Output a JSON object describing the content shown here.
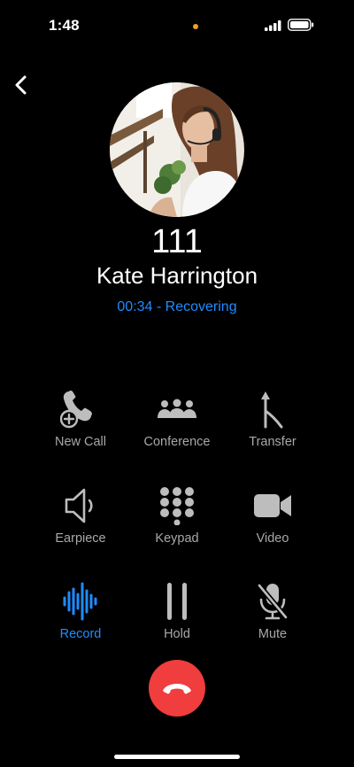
{
  "status_bar": {
    "time": "1:48"
  },
  "caller": {
    "number": "111",
    "name": "Kate Harrington",
    "call_status": "00:34 - Recovering"
  },
  "controls": {
    "new_call": "New Call",
    "conference": "Conference",
    "transfer": "Transfer",
    "earpiece": "Earpiece",
    "keypad": "Keypad",
    "video": "Video",
    "record": "Record",
    "hold": "Hold",
    "mute": "Mute"
  },
  "colors": {
    "accent": "#1f8cff",
    "end_call": "#f03d3d",
    "recording_dot": "#f0a020"
  },
  "icons": {
    "back": "chevron-left-icon",
    "new_call": "phone-add-icon",
    "conference": "people-group-icon",
    "transfer": "transfer-arrow-icon",
    "earpiece": "speaker-icon",
    "keypad": "keypad-grid-icon",
    "video": "video-camera-icon",
    "record": "waveform-icon",
    "hold": "pause-icon",
    "mute": "mic-slash-icon",
    "end_call": "phone-down-icon"
  }
}
